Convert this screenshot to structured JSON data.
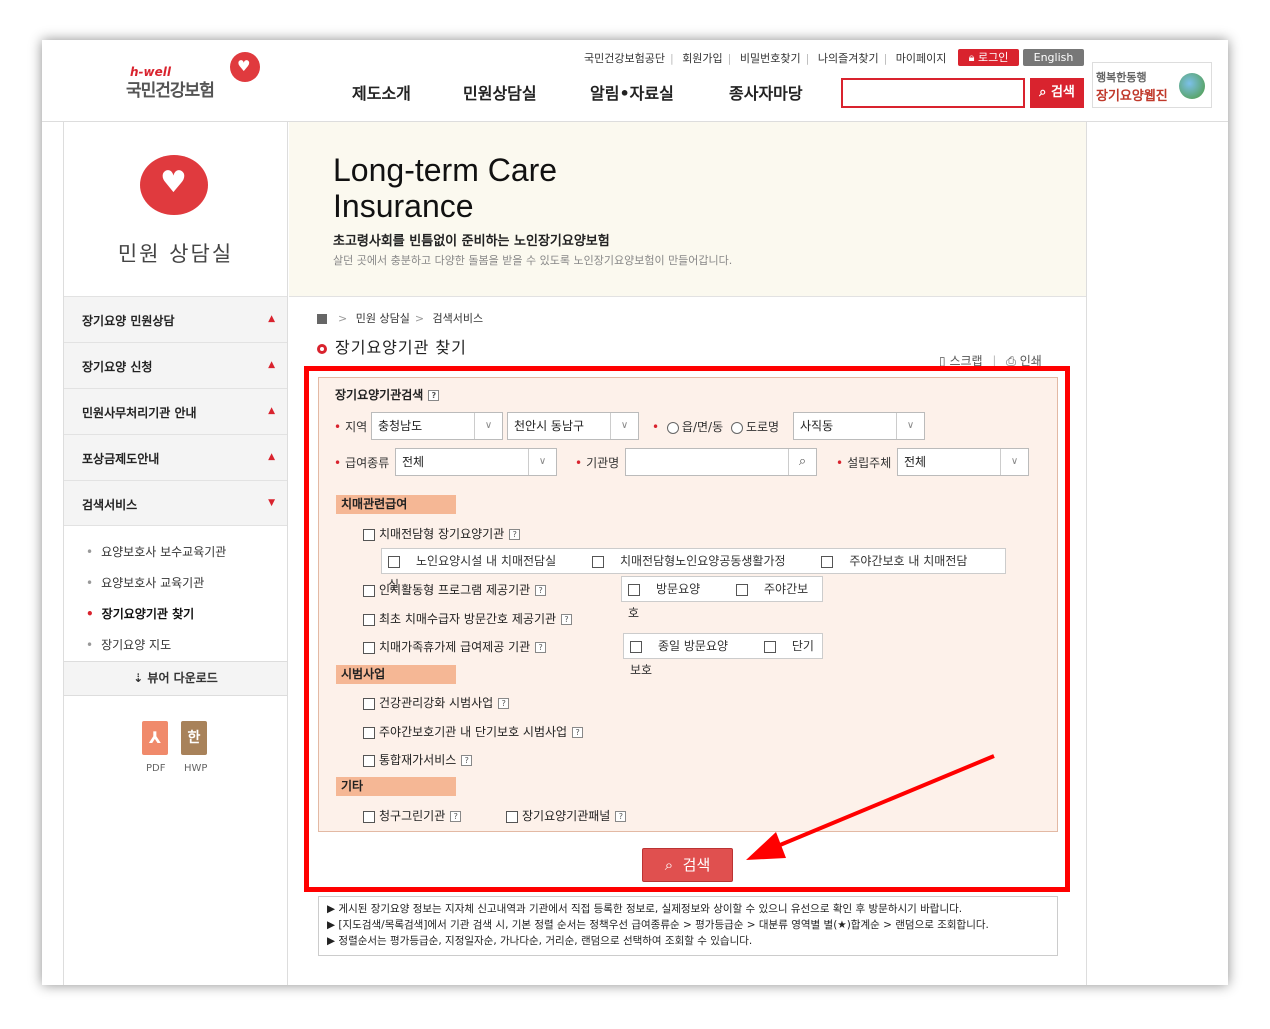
{
  "header": {
    "logo_small": "h-well",
    "logo_main": "국민건강보험",
    "util_links": [
      "국민건강보험공단",
      "회원가입",
      "비밀번호찾기",
      "나의즐겨찾기",
      "마이페이지"
    ],
    "login_label": "로그인",
    "english_label": "English",
    "gnb": [
      "제도소개",
      "민원상담실",
      "알림•자료실",
      "종사자마당"
    ],
    "search_button": "검색",
    "banner_line1": "행복한동행",
    "banner_line2": "장기요양웹진"
  },
  "sidebar": {
    "title": "민원 상담실",
    "menu": [
      "장기요양 민원상담",
      "장기요양 신청",
      "민원사무처리기관 안내",
      "포상금제도안내",
      "검색서비스"
    ],
    "sub_items": [
      "요양보호사 보수교육기관",
      "요양보호사 교육기관",
      "장기요양기관 찾기",
      "장기요양 지도"
    ],
    "viewer_label": "뷰어 다운로드",
    "pdf_label": "PDF",
    "hwp_label": "HWP",
    "hwp_glyph": "한"
  },
  "visual": {
    "title_line1": "Long-term Care",
    "title_line2": "Insurance",
    "subtitle": "초고령사회를 빈틈없이 준비하는 노인장기요양보험",
    "desc": "살던 곳에서 충분하고 다양한 돌봄을 받을 수 있도록 노인장기요양보험이 만들어갑니다."
  },
  "breadcrumb": [
    "민원 상담실",
    "검색서비스"
  ],
  "page_title": "장기요양기관 찾기",
  "tools": {
    "scrap": "스크랩",
    "print": "인쇄"
  },
  "form": {
    "heading": "장기요양기관검색",
    "region_label": "지역",
    "region1": "충청남도",
    "region2": "천안시 동남구",
    "radio1": "읍/면/동",
    "radio2": "도로명",
    "region3": "사직동",
    "benefit_label": "급여종류",
    "benefit_value": "전체",
    "org_label": "기관명",
    "org_value": "",
    "founder_label": "설립주체",
    "founder_value": "전체",
    "sec_dementia": "치매관련급여",
    "dementia_items": [
      "치매전담형 장기요양기관",
      "인지활동형 프로그램 제공기관",
      "최초 치매수급자 방문간호 제공기관",
      "치매가족휴가제 급여제공 기관"
    ],
    "dementia_sub1": [
      "노인요양시설 내 치매전담실",
      "치매전담형노인요양공동생활가정",
      "주야간보호 내 치매전담실"
    ],
    "dementia_sub2": [
      "방문요양",
      "주야간보호"
    ],
    "dementia_sub3": [
      "종일 방문요양",
      "단기보호"
    ],
    "sec_pilot": "시범사업",
    "pilot_items": [
      "건강관리강화 시범사업",
      "주야간보호기관 내 단기보호 시범사업",
      "통합재가서비스"
    ],
    "sec_etc": "기타",
    "etc_items": [
      "청구그린기관",
      "장기요양기관패널"
    ],
    "submit": "검색"
  },
  "notice": [
    "게시된 장기요양 정보는 지자체 신고내역과 기관에서 직접 등록한 정보로, 실제정보와 상이할 수 있으니 유선으로 확인 후 방문하시기 바랍니다.",
    "[지도검색/목록검색]에서 기관 검색 시, 기본 정렬 순서는 정책우선 급여종류순 > 평가등급순 > 대분류 영역별 별(★)합계순 > 랜덤으로 조회합니다.",
    "정렬순서는 평가등급순, 지정일자순, 가나다순, 거리순, 랜덤으로 선택하여 조회할 수 있습니다."
  ],
  "colors": {
    "brand": "#d9232e",
    "highlight": "#ff0000",
    "form_bg": "#fdf1ea",
    "section_tag": "#f5b795"
  }
}
